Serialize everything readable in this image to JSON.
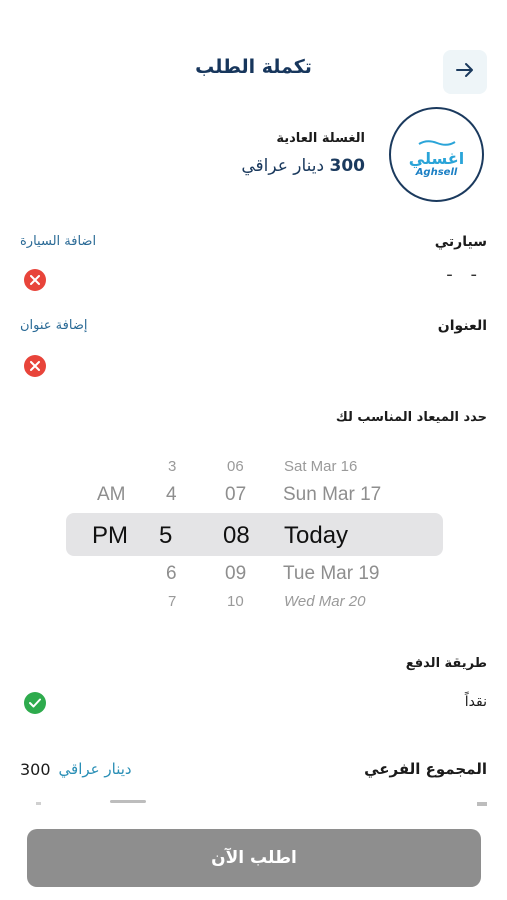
{
  "header": {
    "title": "تكملة الطلب"
  },
  "service": {
    "logo_ar": "اغسلي",
    "logo_en": "Aghsell",
    "name": "الغسلة العادية",
    "price_amount": "300",
    "price_currency": "دينار عراقي"
  },
  "car": {
    "label": "سيارتي",
    "action": "اضافة السيارة",
    "value": "- -"
  },
  "address": {
    "label": "العنوان",
    "action": "إضافة عنوان"
  },
  "schedule": {
    "label": "حدد الميعاد المناسب لك",
    "rows": [
      {
        "ampm": "",
        "hour": "3",
        "minute": "06",
        "day": "Sat Mar 16"
      },
      {
        "ampm": "AM",
        "hour": "4",
        "minute": "07",
        "day": "Sun Mar 17"
      },
      {
        "ampm": "PM",
        "hour": "5",
        "minute": "08",
        "day": "Today"
      },
      {
        "ampm": "",
        "hour": "6",
        "minute": "09",
        "day": "Tue Mar 19"
      },
      {
        "ampm": "",
        "hour": "7",
        "minute": "10",
        "day": "Wed Mar 20"
      }
    ]
  },
  "payment": {
    "label": "طريقة الدفع",
    "method": "نقداً"
  },
  "subtotal": {
    "label": "المجموع الفرعي",
    "amount": "300",
    "currency": "دينار عراقي"
  },
  "submit": {
    "label": "اطلب الآن"
  },
  "colors": {
    "accent": "#17365c",
    "danger": "#e8443a",
    "success": "#2eab4d",
    "button": "#8e8e8e"
  }
}
